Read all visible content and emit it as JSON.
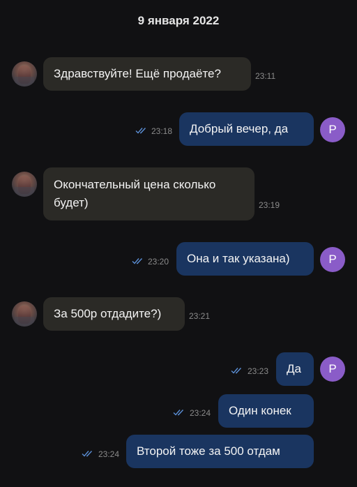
{
  "date_header": "9 января 2022",
  "avatar_letter": "Р",
  "colors": {
    "background": "#111113",
    "incoming_bubble": "#2b2a26",
    "outgoing_bubble": "#1a3560",
    "avatar_accent": "#8a5cc8",
    "read_check": "#5b8fd6"
  },
  "messages": [
    {
      "direction": "incoming",
      "text": "Здравствуйте! Ещё продаёте?",
      "time": "23:11"
    },
    {
      "direction": "outgoing",
      "text": "Добрый вечер, да",
      "time": "23:18",
      "status": "read"
    },
    {
      "direction": "incoming",
      "text_line1": "Окончательный цена сколько",
      "text_line2": "будет)",
      "time": "23:19"
    },
    {
      "direction": "outgoing",
      "text": "Она и так указана)",
      "time": "23:20",
      "status": "read"
    },
    {
      "direction": "incoming",
      "text": "За 500р отдадите?)",
      "time": "23:21"
    },
    {
      "direction": "outgoing",
      "text": "Да",
      "time": "23:23",
      "status": "read"
    },
    {
      "direction": "outgoing",
      "text": "Один конек",
      "time": "23:24",
      "status": "read"
    },
    {
      "direction": "outgoing",
      "text": "Второй тоже за 500 отдам",
      "time": "23:24",
      "status": "read"
    }
  ]
}
